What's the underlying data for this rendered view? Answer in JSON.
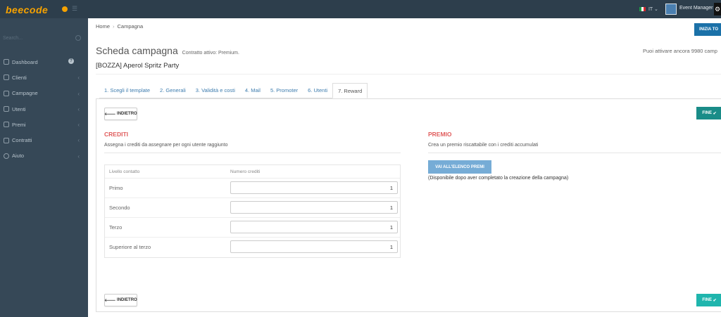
{
  "app": {
    "logo_text": "beecode"
  },
  "topbar": {
    "lang": "IT",
    "user_name": "Event Manager"
  },
  "sidebar": {
    "search_placeholder": "Search...",
    "items": [
      {
        "label": "Dashboard",
        "icon": "home-icon"
      },
      {
        "label": "Clienti",
        "icon": "briefcase-icon"
      },
      {
        "label": "Campagne",
        "icon": "list-icon"
      },
      {
        "label": "Utenti",
        "icon": "user-icon"
      },
      {
        "label": "Premi",
        "icon": "trophy-icon"
      },
      {
        "label": "Contratti",
        "icon": "folder-icon"
      },
      {
        "label": "Aiuto",
        "icon": "help-circle-icon"
      }
    ]
  },
  "breadcrumb": {
    "home": "Home",
    "current": "Campagna"
  },
  "header": {
    "start_button": "INIZIA TO",
    "title": "Scheda campagna",
    "subtitle": "Contratto attivo: Premium.",
    "quota": "Puoi attivare ancora 9980 camp",
    "campaign_name": "[BOZZA] Aperol Spritz Party"
  },
  "tabs": [
    "1. Scegli il template",
    "2. Generali",
    "3. Validità e costi",
    "4. Mail",
    "5. Promoter",
    "6. Utenti",
    "7. Reward"
  ],
  "active_tab": 6,
  "actions": {
    "back_label": "INDIETRO",
    "finish_top_label": "FINE",
    "finish_label": "FINE"
  },
  "credits": {
    "title": "CREDITI",
    "description": "Assegna i crediti da assegnare per ogni utente raggiunto",
    "col_level": "Livello contatto",
    "col_credits": "Numero crediti",
    "rows": [
      {
        "level": "Primo",
        "credits": "1"
      },
      {
        "level": "Secondo",
        "credits": "1"
      },
      {
        "level": "Terzo",
        "credits": "1"
      },
      {
        "level": "Superiore al terzo",
        "credits": "1"
      }
    ]
  },
  "prize": {
    "title": "PREMIO",
    "description": "Crea un premio riscattabile con i crediti accumulati",
    "button": "VAI ALL'ELENCO PREMI",
    "note": "(Disponibile dopo aver completato la creazione della campagna)"
  },
  "colors": {
    "topbar": "#2d3e4c",
    "sidebar": "#364857",
    "accent_teal": "#1fb5ad",
    "section_title": "#e05d5d",
    "link": "#3d7cae"
  }
}
